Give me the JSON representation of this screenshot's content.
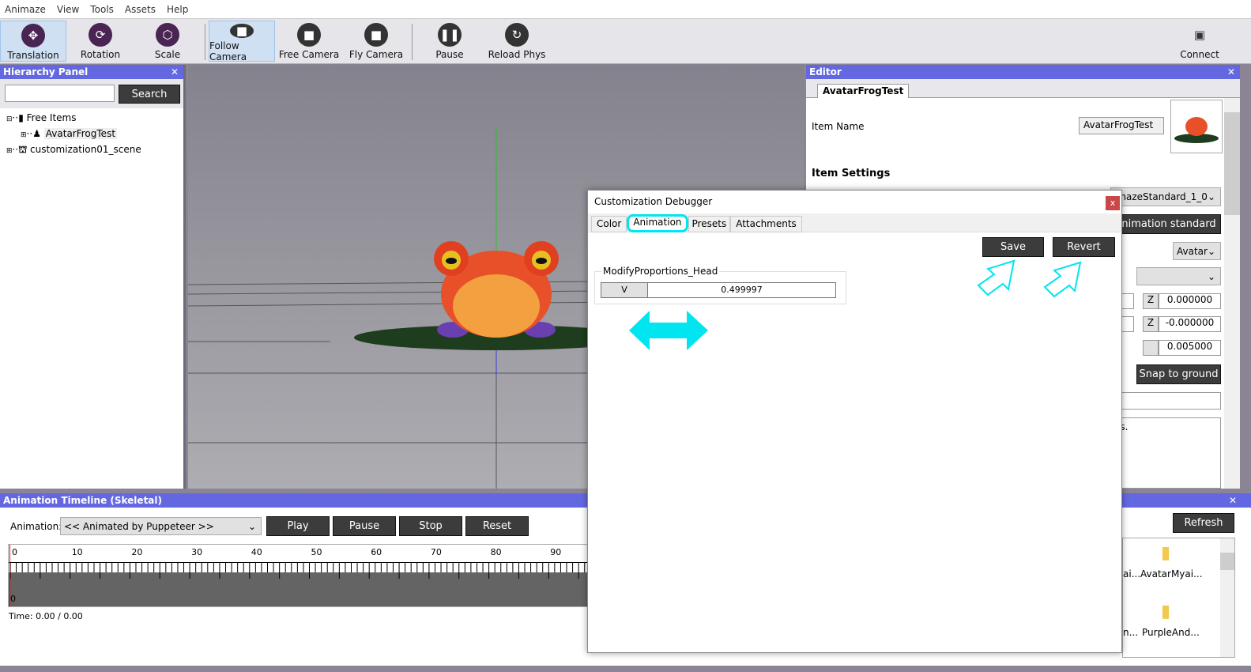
{
  "menu": [
    "Animaze",
    "View",
    "Tools",
    "Assets",
    "Help"
  ],
  "toolbar": {
    "items": [
      {
        "label": "Translation",
        "icon": "move-arrows-icon",
        "selected": true
      },
      {
        "label": "Rotation",
        "icon": "rotate-icon",
        "selected": false
      },
      {
        "label": "Scale",
        "icon": "scale-icon",
        "selected": false
      },
      {
        "label": "Follow Camera",
        "icon": "camera-icon",
        "selected": true
      },
      {
        "label": "Free Camera",
        "icon": "camera-icon",
        "selected": false
      },
      {
        "label": "Fly Camera",
        "icon": "camera-icon",
        "selected": false
      },
      {
        "label": "Pause",
        "icon": "pause-icon",
        "selected": false
      },
      {
        "label": "Reload Phys",
        "icon": "reload-icon",
        "selected": false
      }
    ],
    "connect": "Connect"
  },
  "hierarchy": {
    "title": "Hierarchy Panel",
    "search_value": "",
    "search_button": "Search",
    "tree": [
      {
        "label": "Free Items",
        "expanded": true
      },
      {
        "label": "AvatarFrogTest",
        "selected": true
      },
      {
        "label": "customization01_scene"
      }
    ]
  },
  "editor": {
    "title": "Editor",
    "tab": "AvatarFrogTest",
    "item_name_label": "Item Name",
    "item_name_value": "AvatarFrogTest",
    "item_settings": "Item Settings",
    "standard_combo": "imazeStandard_1_0",
    "standard_button": "animation standard",
    "type_combo": "Avatar",
    "empty_combo": "",
    "z_label": "Z",
    "z1": "0.000000",
    "z2": "-0.000000",
    "scale_value": "0.005000",
    "snap_button": "Snap to ground",
    "desc_fragment": "es."
  },
  "timeline": {
    "title": "Animation Timeline (Skeletal)",
    "animation_label": "Animation:",
    "animation_value": "<< Animated by Puppeteer >>",
    "buttons": [
      "Play",
      "Pause",
      "Stop",
      "Reset"
    ],
    "ticks": [
      "0",
      "10",
      "20",
      "30",
      "40",
      "50",
      "60",
      "70",
      "80",
      "90"
    ],
    "row_label": "0",
    "time": "Time: 0.00 / 0.00"
  },
  "assets": {
    "refresh": "Refresh",
    "items": [
      "ai...",
      "AvatarMyai...",
      "n...",
      "PurpleAnd..."
    ]
  },
  "dialog": {
    "title": "Customization Debugger",
    "close": "x",
    "tabs": [
      "Color",
      "Animation",
      "Presets",
      "Attachments"
    ],
    "active_tab": "Animation",
    "save": "Save",
    "revert": "Revert",
    "group_label": "ModifyProportions_Head",
    "field_label": "V",
    "field_value": "0.499997"
  },
  "colors": {
    "panel_header": "#6468e0",
    "annotation": "#00e5f0",
    "dark_button": "#3c3c3c"
  }
}
